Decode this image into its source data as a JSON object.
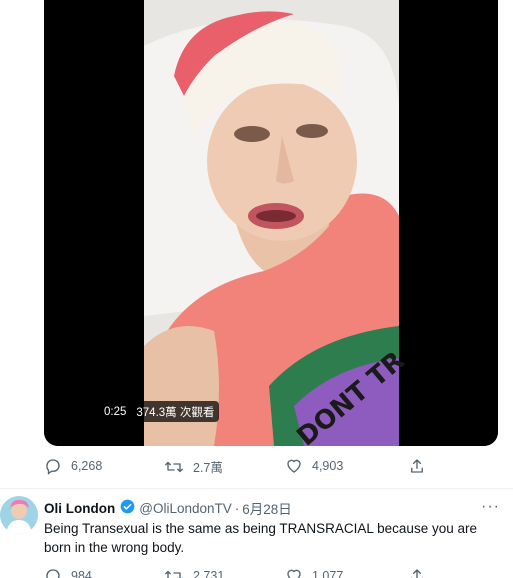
{
  "video": {
    "time": "0:25",
    "views": "374.3萬 次觀看",
    "shirt_text": "DONT TR"
  },
  "tweet1": {
    "reply_count": "6,268",
    "retweet_count": "2.7萬",
    "like_count": "4,903"
  },
  "tweet2": {
    "name": "Oli London",
    "handle": "@OliLondonTV",
    "separator": "·",
    "date": "6月28日",
    "more": "···",
    "text": "Being Transexual is the same as being TRANSRACIAL because you are born in the wrong body.",
    "reply_count": "984",
    "retweet_count": "2,731",
    "like_count": "1,077"
  },
  "colors": {
    "accent": "#1d9bf0",
    "muted": "#536471",
    "shirt": "#f2837a"
  },
  "icons": [
    "reply-icon",
    "retweet-icon",
    "like-icon",
    "share-icon",
    "verified-badge-icon",
    "more-icon"
  ]
}
